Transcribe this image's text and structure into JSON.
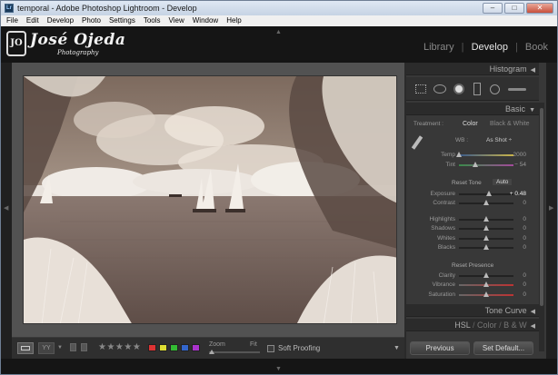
{
  "window": {
    "title": "temporal - Adobe Photoshop Lightroom - Develop",
    "app_icon": "Lr",
    "controls": [
      "–",
      "□",
      "✕"
    ]
  },
  "menubar": {
    "items": [
      "File",
      "Edit",
      "Develop",
      "Photo",
      "Settings",
      "Tools",
      "View",
      "Window",
      "Help"
    ]
  },
  "identity": {
    "logo_mark": "JO",
    "name": "José Ojeda",
    "sub": "Photography"
  },
  "modules": {
    "items": [
      "Library",
      "Develop",
      "Book"
    ],
    "separator": "|",
    "active": "Develop"
  },
  "panel": {
    "histogram": "Histogram",
    "basic": "Basic",
    "treatment_label": "Treatment :",
    "treatment_color": "Color",
    "treatment_bw": "Black & White",
    "wb_label": "WB :",
    "wb_value": "As Shot ÷",
    "temp": {
      "label": "Temp",
      "value": "2000",
      "pos": 0.0
    },
    "tint": {
      "label": "Tint",
      "value": "− 54",
      "pos": 0.3
    },
    "reset_tone": "Reset Tone",
    "auto": "Auto",
    "exposure": {
      "label": "Exposure",
      "value": "+ 0.48",
      "pos": 0.55
    },
    "contrast": {
      "label": "Contrast",
      "value": "0",
      "pos": 0.5
    },
    "highlights": {
      "label": "Highlights",
      "value": "0",
      "pos": 0.5
    },
    "shadows": {
      "label": "Shadows",
      "value": "0",
      "pos": 0.5
    },
    "whites": {
      "label": "Whites",
      "value": "0",
      "pos": 0.5
    },
    "blacks": {
      "label": "Blacks",
      "value": "0",
      "pos": 0.5
    },
    "reset_presence": "Reset Presence",
    "clarity": {
      "label": "Clarity",
      "value": "0",
      "pos": 0.5
    },
    "vibrance": {
      "label": "Vibrance",
      "value": "0",
      "pos": 0.5
    },
    "saturation": {
      "label": "Saturation",
      "value": "0",
      "pos": 0.5
    },
    "tone_curve": "Tone Curve",
    "hsl": "HSL",
    "hsl_sep1": "/",
    "color": "Color",
    "hsl_sep2": "/",
    "bw": "B & W",
    "previous": "Previous",
    "set_default": "Set Default..."
  },
  "toolbar": {
    "rating_stars": "★★★★★",
    "zoom_label": "Zoom",
    "fit_label": "Fit",
    "soft_proofing": "Soft Proofing",
    "color_labels": [
      "#d33",
      "#dd3",
      "#3b3",
      "#36c",
      "#a3c"
    ]
  }
}
